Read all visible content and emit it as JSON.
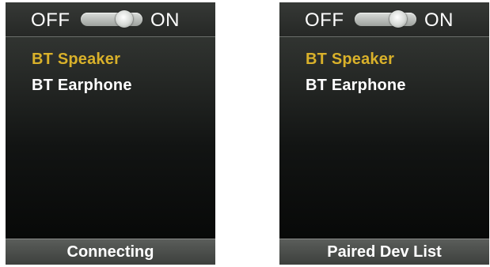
{
  "screens": [
    {
      "toggle": {
        "off_label": "OFF",
        "on_label": "ON",
        "state": "on"
      },
      "menu": [
        {
          "label": "BT Speaker",
          "selected": true
        },
        {
          "label": "BT Earphone",
          "selected": false
        }
      ],
      "footer": "Connecting"
    },
    {
      "toggle": {
        "off_label": "OFF",
        "on_label": "ON",
        "state": "on"
      },
      "menu": [
        {
          "label": "BT Speaker",
          "selected": true
        },
        {
          "label": "BT Earphone",
          "selected": false
        }
      ],
      "footer": "Paired Dev List"
    }
  ],
  "colors": {
    "selected": "#d9b12a",
    "text": "#ffffff",
    "background": "#0b0c0b"
  }
}
